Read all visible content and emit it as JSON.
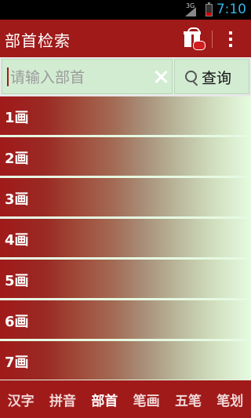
{
  "status_bar": {
    "network": "3G",
    "time": "7:10"
  },
  "action_bar": {
    "title": "部首检索",
    "gift_icon": "gift-icon",
    "overflow_icon": "overflow-menu-icon"
  },
  "search": {
    "placeholder": "请输入部首",
    "value": "",
    "clear_icon": "clear-icon",
    "query_label": "查询",
    "query_icon": "search-icon"
  },
  "strokes": [
    {
      "label": "1画"
    },
    {
      "label": "2画"
    },
    {
      "label": "3画"
    },
    {
      "label": "4画"
    },
    {
      "label": "5画"
    },
    {
      "label": "6画"
    },
    {
      "label": "7画"
    }
  ],
  "tabs": [
    {
      "label": "汉字"
    },
    {
      "label": "拼音"
    },
    {
      "label": "部首"
    },
    {
      "label": "笔画"
    },
    {
      "label": "五笔"
    },
    {
      "label": "笔划"
    }
  ],
  "active_tab": "部首",
  "colors": {
    "primary": "#a01a1a",
    "search_bg": "#d2ecd2",
    "list_end": "#e6fbe0"
  }
}
